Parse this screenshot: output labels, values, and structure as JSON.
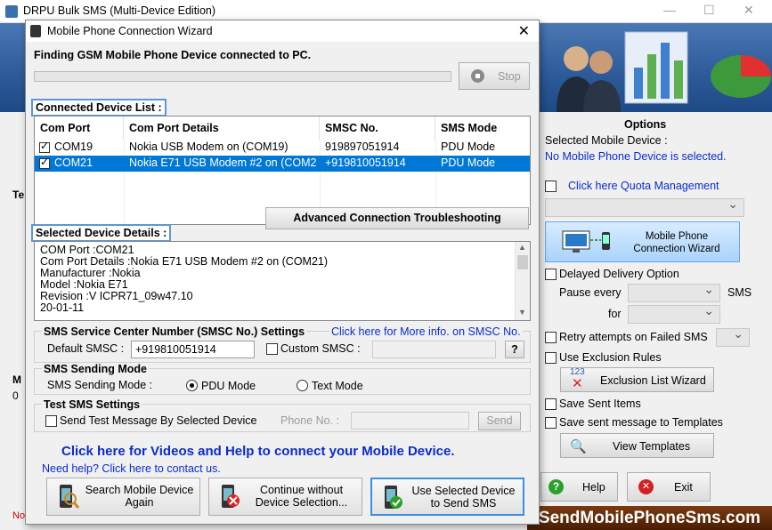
{
  "main": {
    "title": "DRPU Bulk SMS (Multi-Device Edition)",
    "left_fragments": {
      "te": "Te",
      "m": "M",
      "zero": "0",
      "no": "No"
    },
    "footer_brand": "SendMobilePhoneSms.com"
  },
  "options": {
    "title": "Options",
    "selected_device_label": "Selected Mobile Device :",
    "no_device_text": "No Mobile Phone Device is selected.",
    "quota_link": "Click here Quota Management",
    "connection_wizard_label": "Mobile Phone Connection  Wizard",
    "delayed_delivery": "Delayed Delivery Option",
    "pause_every": "Pause every",
    "sms_unit": "SMS",
    "for_label": "for",
    "retry_attempts": "Retry attempts on Failed SMS",
    "use_exclusion": "Use Exclusion Rules",
    "exclusion_wizard": "Exclusion List Wizard",
    "save_sent_items": "Save Sent Items",
    "save_sent_templates": "Save sent message to Templates",
    "view_templates": "View Templates",
    "help": "Help",
    "exit": "Exit",
    "exclusion_icon_text": "123"
  },
  "dialog": {
    "title": "Mobile Phone Connection Wizard",
    "finding_text": "Finding GSM Mobile Phone Device connected to PC.",
    "stop_label": "Stop",
    "connected_list_label": "Connected Device List :",
    "columns": [
      "Com Port",
      "Com Port Details",
      "SMSC No.",
      "SMS Mode"
    ],
    "rows": [
      {
        "port": "COM19",
        "details": "Nokia USB Modem on (COM19)",
        "smsc": "919897051914",
        "mode": "PDU Mode"
      },
      {
        "port": "COM21",
        "details": "Nokia E71 USB Modem #2 on (COM21)",
        "smsc": "+919810051914",
        "mode": "PDU Mode"
      }
    ],
    "advanced_button": "Advanced Connection Troubleshooting",
    "selected_details_label": "Selected Device Details :",
    "details_lines": [
      "COM Port :COM21",
      "Com Port Details :Nokia E71 USB Modem #2 on (COM21)",
      "Manufacturer :Nokia",
      "Model :Nokia E71",
      "Revision :V ICPR71_09w47.10",
      "20-01-11"
    ],
    "smsc_settings_title": "SMS Service Center Number (SMSC No.) Settings",
    "smsc_info_link": "Click here for More info. on SMSC No.",
    "default_smsc_label": "Default SMSC :",
    "default_smsc_value": "+919810051914",
    "custom_smsc_label": "Custom SMSC :",
    "question_button": "?",
    "sending_mode_title": "SMS Sending Mode",
    "sending_mode_label": "SMS Sending Mode :",
    "pdu_mode": "PDU Mode",
    "text_mode": "Text Mode",
    "test_sms_title": "Test SMS Settings",
    "send_test_label": "Send Test Message By Selected Device",
    "phone_no_label": "Phone No. :",
    "send_button": "Send",
    "videos_help_link": "Click here for Videos and Help to connect your Mobile Device.",
    "need_help_link": "Need help? Click here to contact us.",
    "search_again": "Search Mobile Device Again",
    "continue_without": "Continue without Device Selection...",
    "use_selected": "Use Selected Device to Send SMS"
  }
}
